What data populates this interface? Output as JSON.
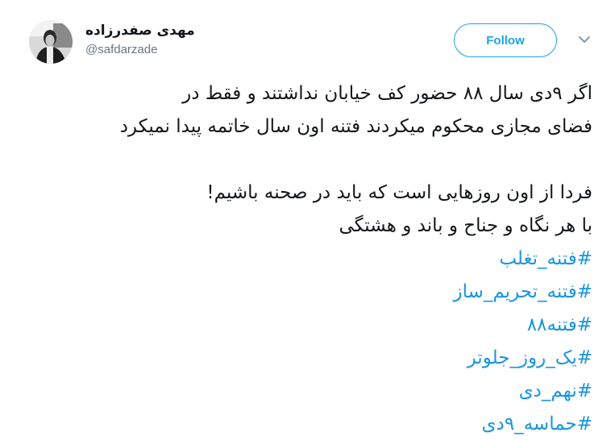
{
  "author": {
    "display_name": "مهدی صفدرزاده",
    "handle": "@safdarzade"
  },
  "follow_button": {
    "label": "Follow"
  },
  "tweet": {
    "lines": [
      "اگر ۹دی سال ۸۸ حضور کف خیابان نداشتند و فقط در",
      "فضای مجازی محکوم میکردند فتنه اون سال خاتمه پیدا نمیکرد",
      "فردا از اون روزهایی است که باید در صحنه باشیم!",
      "با هر نگاه و جناح و باند و هشتگی"
    ],
    "hashtags": [
      "#فتنه_تغلب",
      "#فتنه_تحریم_ساز",
      "#فتنه۸۸",
      "#یک_روز_جلوتر",
      "#نهم_دی",
      "#حماسه_۹دی"
    ]
  },
  "colors": {
    "accent": "#1da1f2",
    "hashtag": "#1b95e0",
    "text": "#14171a",
    "secondary": "#657786"
  }
}
